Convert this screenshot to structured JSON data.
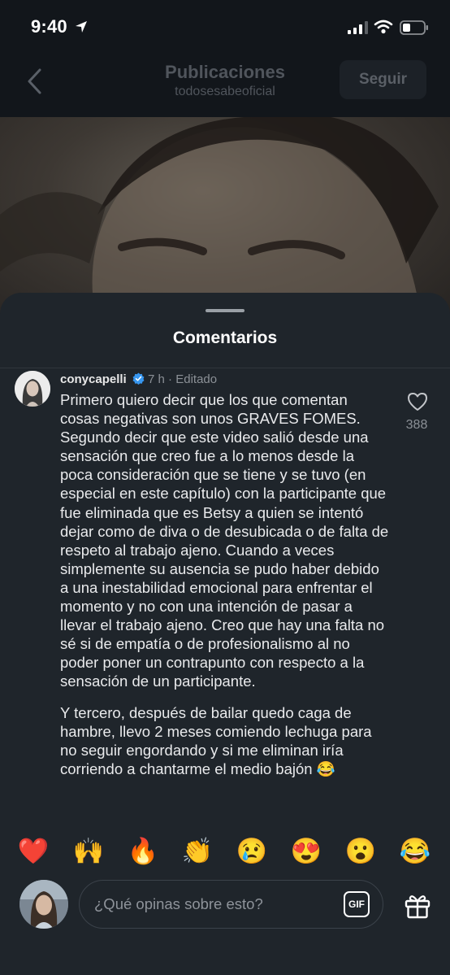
{
  "status_bar": {
    "time": "9:40"
  },
  "header": {
    "title": "Publicaciones",
    "subtitle": "todosesabeoficial",
    "follow_label": "Seguir"
  },
  "sheet": {
    "title": "Comentarios"
  },
  "comment": {
    "username": "conycapelli",
    "meta": " 7 h · Editado",
    "paragraph_1": "Primero quiero decir que los que comentan cosas negativas son unos GRAVES FOMES. Segundo decir que este video salió desde una sensación que creo fue a lo menos desde la poca consideración que se tiene y se tuvo (en especial en este capítulo) con la participante que fue eliminada que es Betsy a quien se intentó dejar como de diva o de desubicada o de falta de respeto al trabajo ajeno. Cuando a veces simplemente su ausencia se pudo haber debido a una inestabilidad emocional para enfrentar el momento y no con una intención de pasar a llevar el trabajo ajeno. Creo que hay una falta no sé si de empatía o de profesionalismo al no poder poner un contrapunto con respecto a la sensación de un participante.",
    "paragraph_2": "Y tercero, después de bailar quedo caga de hambre, llevo 2 meses comiendo lechuga para no seguir engordando y si me eliminan iría corriendo a chantarme el medio bajón 😂",
    "likes": "388"
  },
  "emoji_bar": [
    "❤️",
    "🙌",
    "🔥",
    "👏",
    "😢",
    "😍",
    "😮",
    "😂"
  ],
  "composer": {
    "placeholder": "¿Qué opinas sobre esto?",
    "gif_label": "GIF"
  },
  "colors": {
    "background": "#12161b",
    "sheet": "#1f252b",
    "muted": "#8b9096",
    "verified": "#3797f0"
  }
}
